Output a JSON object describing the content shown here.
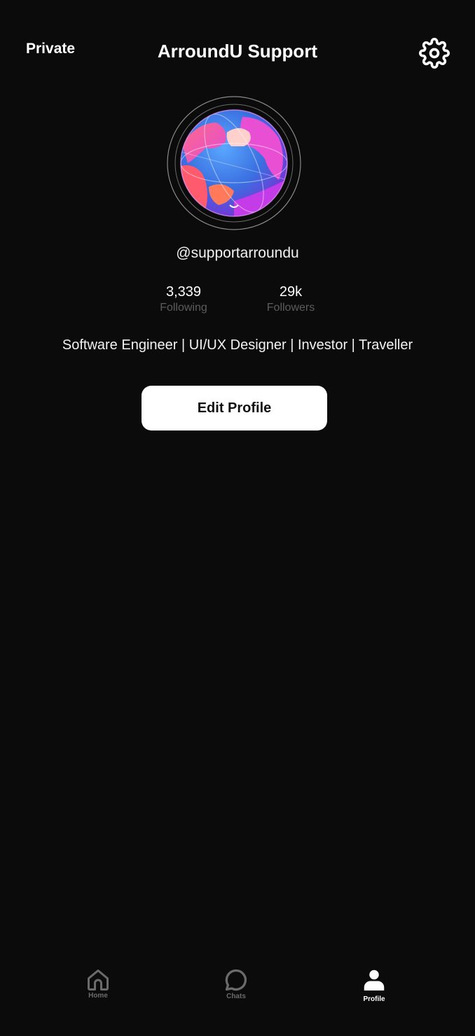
{
  "header": {
    "privacy_label": "Private",
    "title": "ArroundU Support",
    "settings_icon": "gear-icon"
  },
  "profile": {
    "avatar_icon": "globe-avatar",
    "handle": "@supportarroundu",
    "stats": {
      "following": {
        "value": "3,339",
        "label": "Following"
      },
      "followers": {
        "value": "29k",
        "label": "Followers"
      }
    },
    "bio": "Software Engineer | UI/UX Designer | Investor | Traveller",
    "edit_button_label": "Edit Profile"
  },
  "bottom_nav": {
    "items": [
      {
        "label": "Home",
        "icon": "home-icon",
        "active": false
      },
      {
        "label": "Chats",
        "icon": "chat-bubble-icon",
        "active": false
      },
      {
        "label": "Profile",
        "icon": "user-icon",
        "active": true
      }
    ]
  },
  "colors": {
    "background": "#0b0b0c",
    "text_primary": "#ffffff",
    "text_muted": "#5c5c5c",
    "nav_inactive": "#6b6b6b",
    "button_bg": "#ffffff",
    "button_text": "#111111"
  }
}
